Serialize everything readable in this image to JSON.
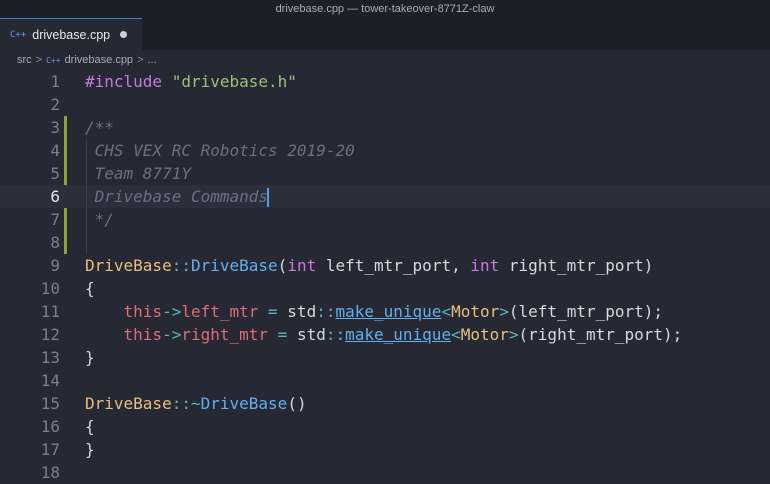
{
  "window": {
    "title": "drivebase.cpp — tower-takeover-8771Z-claw"
  },
  "tab": {
    "icon": "cpp-file-icon",
    "filename": "drivebase.cpp"
  },
  "breadcrumb": {
    "folder": "src",
    "file": "drivebase.cpp",
    "more": "..."
  },
  "editor": {
    "active_line": 6,
    "lines": [
      {
        "n": "1",
        "tokens": [
          {
            "c": "inc",
            "t": "#include "
          },
          {
            "c": "str",
            "t": "\"drivebase.h\""
          }
        ]
      },
      {
        "n": "2",
        "tokens": []
      },
      {
        "n": "3",
        "tokens": [
          {
            "c": "com",
            "t": "/**"
          }
        ]
      },
      {
        "n": "4",
        "tokens": [
          {
            "c": "com",
            "t": " CHS VEX RC Robotics 2019-20"
          }
        ]
      },
      {
        "n": "5",
        "tokens": [
          {
            "c": "com",
            "t": " Team 8771Y"
          }
        ]
      },
      {
        "n": "6",
        "tokens": [
          {
            "c": "com",
            "t": " Drivebase Commands"
          }
        ]
      },
      {
        "n": "7",
        "tokens": [
          {
            "c": "com",
            "t": " */"
          }
        ]
      },
      {
        "n": "8",
        "tokens": []
      },
      {
        "n": "9",
        "tokens": [
          {
            "c": "cls",
            "t": "DriveBase"
          },
          {
            "c": "op",
            "t": "::"
          },
          {
            "c": "fn",
            "t": "DriveBase"
          },
          {
            "c": "par",
            "t": "("
          },
          {
            "c": "kw",
            "t": "int"
          },
          {
            "c": "par",
            "t": " left_mtr_port, "
          },
          {
            "c": "kw",
            "t": "int"
          },
          {
            "c": "par",
            "t": " right_mtr_port)"
          }
        ]
      },
      {
        "n": "10",
        "tokens": [
          {
            "c": "par",
            "t": "{"
          }
        ]
      },
      {
        "n": "11",
        "tokens": [
          {
            "c": "par",
            "t": "    "
          },
          {
            "c": "this",
            "t": "this"
          },
          {
            "c": "op",
            "t": "->"
          },
          {
            "c": "mem",
            "t": "left_mtr"
          },
          {
            "c": "op",
            "t": " = "
          },
          {
            "c": "par",
            "t": "std"
          },
          {
            "c": "op",
            "t": "::"
          },
          {
            "c": "fnu",
            "t": "make_unique"
          },
          {
            "c": "op",
            "t": "<"
          },
          {
            "c": "cls",
            "t": "Motor"
          },
          {
            "c": "op",
            "t": ">"
          },
          {
            "c": "par",
            "t": "(left_mtr_port);"
          }
        ]
      },
      {
        "n": "12",
        "tokens": [
          {
            "c": "par",
            "t": "    "
          },
          {
            "c": "this",
            "t": "this"
          },
          {
            "c": "op",
            "t": "->"
          },
          {
            "c": "mem",
            "t": "right_mtr"
          },
          {
            "c": "op",
            "t": " = "
          },
          {
            "c": "par",
            "t": "std"
          },
          {
            "c": "op",
            "t": "::"
          },
          {
            "c": "fnu",
            "t": "make_unique"
          },
          {
            "c": "op",
            "t": "<"
          },
          {
            "c": "cls",
            "t": "Motor"
          },
          {
            "c": "op",
            "t": ">"
          },
          {
            "c": "par",
            "t": "(right_mtr_port);"
          }
        ]
      },
      {
        "n": "13",
        "tokens": [
          {
            "c": "par",
            "t": "}"
          }
        ]
      },
      {
        "n": "14",
        "tokens": []
      },
      {
        "n": "15",
        "tokens": [
          {
            "c": "cls",
            "t": "DriveBase"
          },
          {
            "c": "op",
            "t": "::~"
          },
          {
            "c": "fn",
            "t": "DriveBase"
          },
          {
            "c": "par",
            "t": "()"
          }
        ]
      },
      {
        "n": "16",
        "tokens": [
          {
            "c": "par",
            "t": "{"
          }
        ]
      },
      {
        "n": "17",
        "tokens": [
          {
            "c": "par",
            "t": "}"
          }
        ]
      },
      {
        "n": "18",
        "tokens": []
      }
    ]
  },
  "colors": {
    "background": "#262833",
    "tab_bar": "#1d1f28",
    "git_modified_gutter": "#8aa33b",
    "cursor": "#4f9cf5"
  }
}
